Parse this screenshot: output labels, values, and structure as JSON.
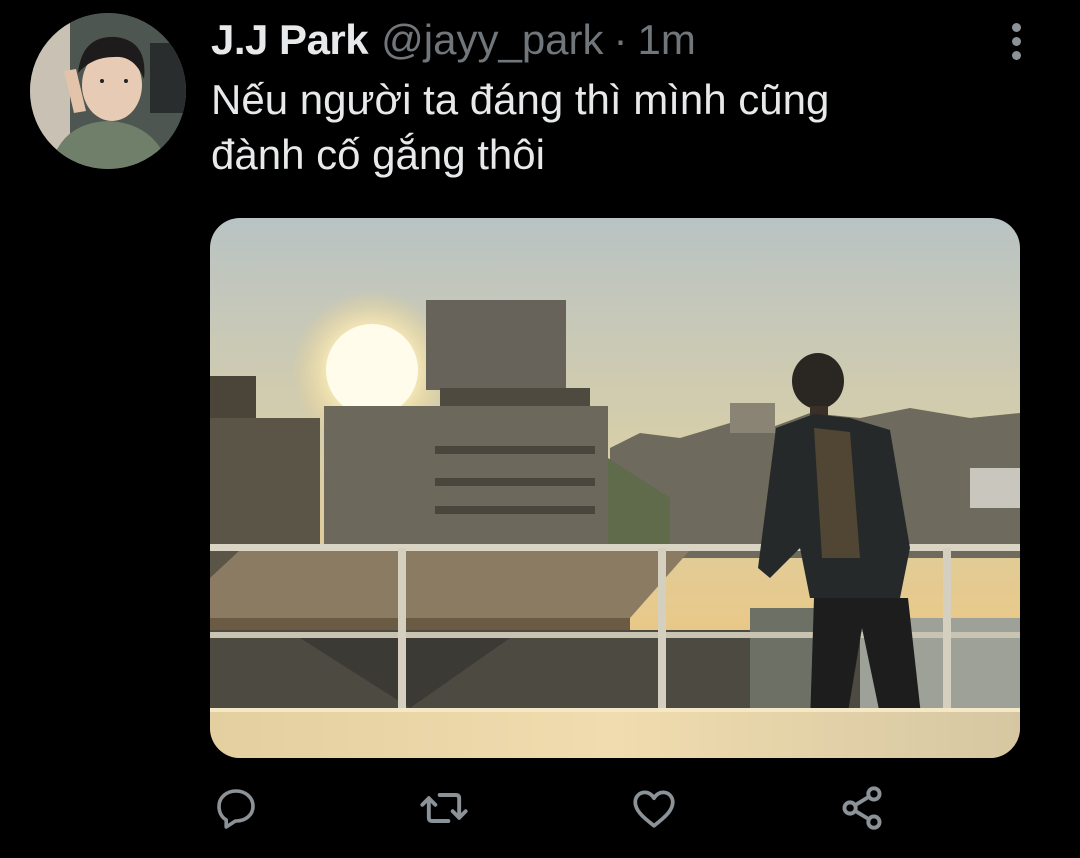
{
  "tweet": {
    "author": {
      "display_name": "J.J Park",
      "handle": "@jayy_park"
    },
    "separator": "·",
    "time": "1m",
    "text_lines": [
      "Nếu người ta đáng thì mình cũng",
      "đành cố gắng thôi"
    ]
  },
  "icons": {
    "more": "more-vertical-icon",
    "reply": "reply-icon",
    "retweet": "retweet-icon",
    "like": "heart-icon",
    "share": "share-icon"
  },
  "colors": {
    "background": "#000000",
    "primary_text": "#e7e9ea",
    "secondary_text": "#71767b",
    "icon": "#8b9298"
  }
}
